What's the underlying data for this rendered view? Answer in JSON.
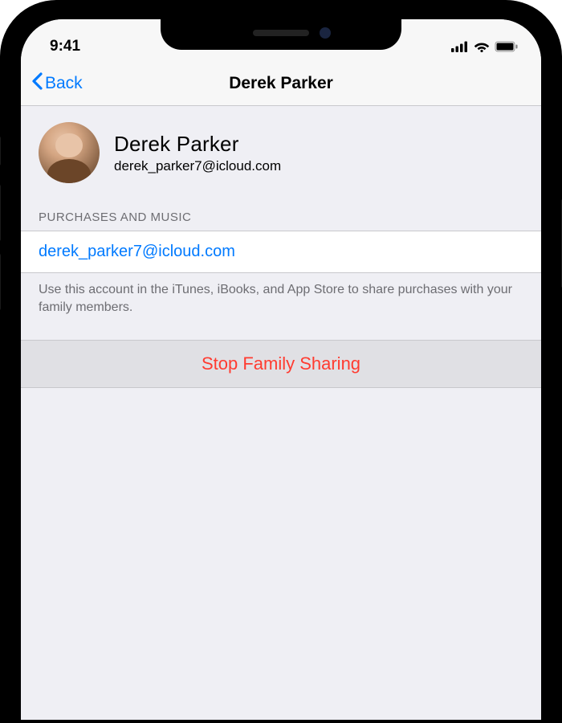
{
  "statusBar": {
    "time": "9:41"
  },
  "nav": {
    "back": "Back",
    "title": "Derek Parker"
  },
  "profile": {
    "name": "Derek Parker",
    "email": "derek_parker7@icloud.com"
  },
  "sections": {
    "purchases": {
      "header": "PURCHASES AND MUSIC",
      "account": "derek_parker7@icloud.com",
      "footer": "Use this account in the iTunes, iBooks, and App Store to share purchases with your family members."
    }
  },
  "actions": {
    "stopSharing": "Stop Family Sharing"
  }
}
